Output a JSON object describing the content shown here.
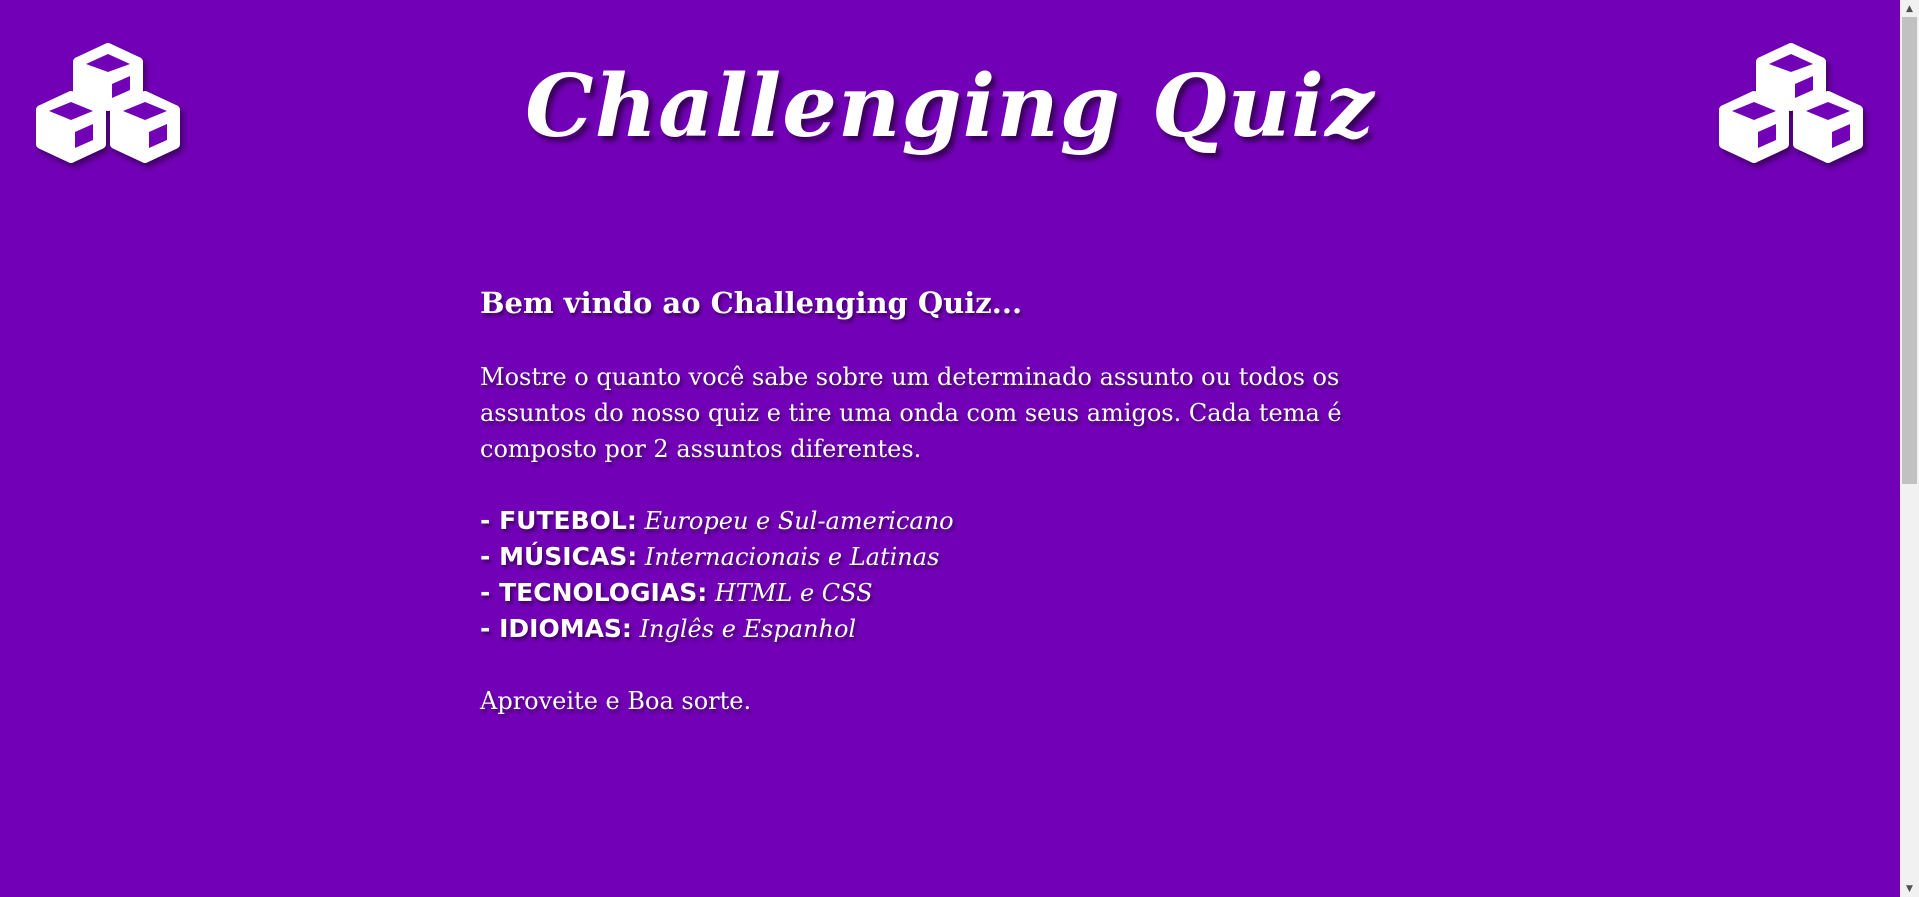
{
  "header": {
    "title": "Challenging Quiz",
    "logo_icon": "cubes-icon"
  },
  "main": {
    "welcome": "Bem vindo ao Challenging Quiz...",
    "intro": "Mostre o quanto você sabe sobre um determinado assunto ou todos os assuntos do nosso quiz e tire uma onda com seus amigos. Cada tema é composto por 2 assuntos diferentes.",
    "topics": [
      {
        "dash": "- ",
        "name": "FUTEBOL:",
        "items": "Europeu e Sul-americano"
      },
      {
        "dash": "- ",
        "name": "MÚSICAS:",
        "items": "Internacionais e Latinas"
      },
      {
        "dash": "- ",
        "name": "TECNOLOGIAS:",
        "items": "HTML e CSS"
      },
      {
        "dash": "- ",
        "name": "IDIOMAS:",
        "items": "Inglês e Espanhol"
      }
    ],
    "closing": "Aproveite e Boa sorte."
  },
  "colors": {
    "background": "#7200b6",
    "text": "#ffffff"
  }
}
